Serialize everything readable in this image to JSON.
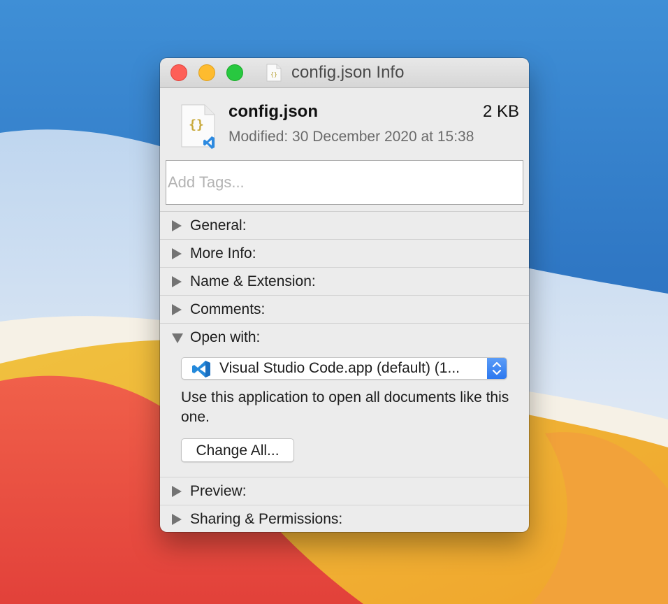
{
  "window": {
    "title": "config.json Info",
    "title_icon": "json-file-icon"
  },
  "file": {
    "name": "config.json",
    "size": "2 KB",
    "modified": "Modified: 30 December 2020 at 15:38",
    "icon": "json-vscode-file-icon"
  },
  "tags": {
    "placeholder": "Add Tags...",
    "value": ""
  },
  "sections": {
    "general": "General:",
    "more_info": "More Info:",
    "name_extension": "Name & Extension:",
    "comments": "Comments:",
    "open_with": "Open with:",
    "preview": "Preview:",
    "sharing": "Sharing & Permissions:"
  },
  "open_with": {
    "app_selected": "Visual Studio Code.app (default) (1...",
    "app_icon": "vscode-icon",
    "description": "Use this application to open all documents like this one.",
    "change_all_label": "Change All..."
  },
  "colors": {
    "close": "#fe5f57",
    "minimize": "#febb2e",
    "maximize": "#28c840",
    "accent": "#2c78ef",
    "vscode_blue": "#0078d4"
  }
}
